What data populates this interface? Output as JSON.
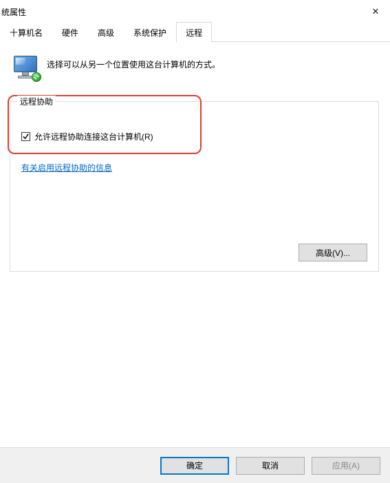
{
  "title": "统属性",
  "tabs": {
    "computer_name": "十算机名",
    "hardware": "硬件",
    "advanced": "高级",
    "system_protection": "系统保护",
    "remote": "远程"
  },
  "intro": "选择可以从另一个位置使用这台计算机的方式。",
  "remote_assist": {
    "legend": "远程协助",
    "checkbox_label": "允许远程协助连接这台计算机(R)",
    "checked": true,
    "help_link": "有关启用远程协助的信息",
    "advanced_button": "高级(V)..."
  },
  "buttons": {
    "ok": "确定",
    "cancel": "取消",
    "apply": "应用(A)"
  }
}
